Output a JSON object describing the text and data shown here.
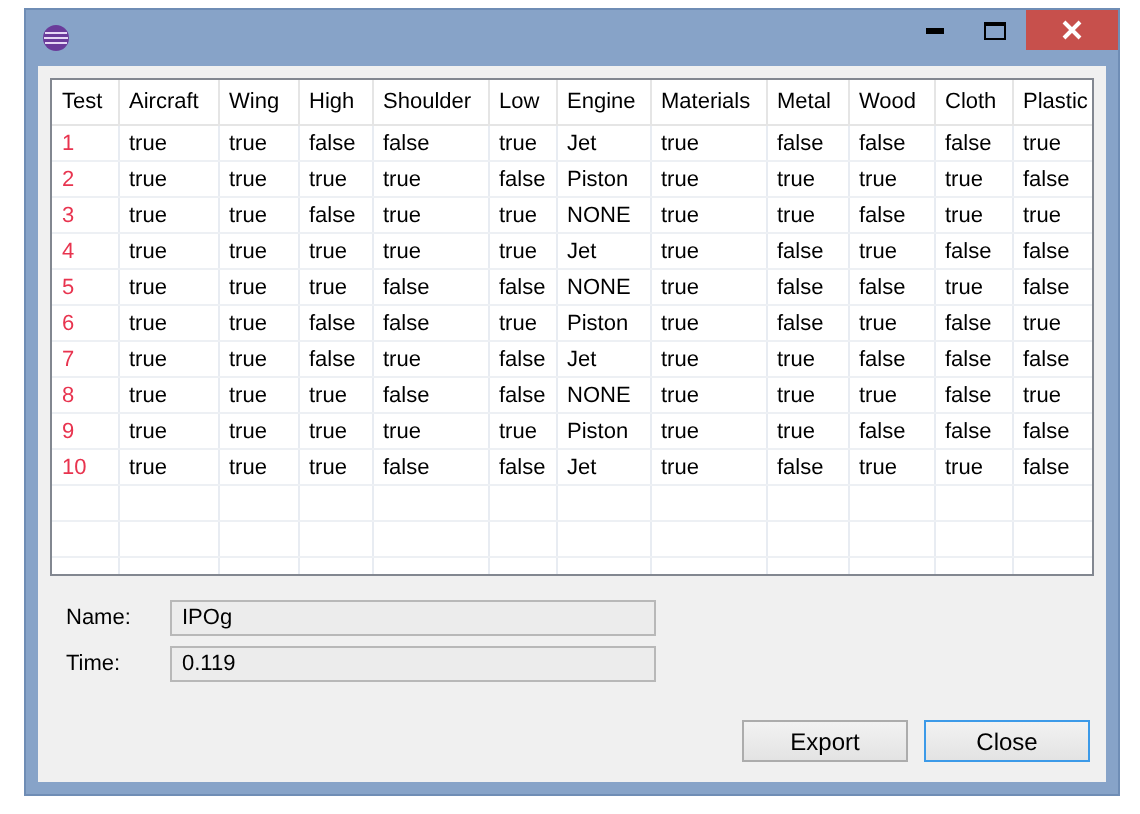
{
  "table": {
    "columns": [
      "Test",
      "Aircraft",
      "Wing",
      "High",
      "Shoulder",
      "Low",
      "Engine",
      "Materials",
      "Metal",
      "Wood",
      "Cloth",
      "Plastic"
    ],
    "rows": [
      [
        "1",
        "true",
        "true",
        "false",
        "false",
        "true",
        "Jet",
        "true",
        "false",
        "false",
        "false",
        "true"
      ],
      [
        "2",
        "true",
        "true",
        "true",
        "true",
        "false",
        "Piston",
        "true",
        "true",
        "true",
        "true",
        "false"
      ],
      [
        "3",
        "true",
        "true",
        "false",
        "true",
        "true",
        "NONE",
        "true",
        "true",
        "false",
        "true",
        "true"
      ],
      [
        "4",
        "true",
        "true",
        "true",
        "true",
        "true",
        "Jet",
        "true",
        "false",
        "true",
        "false",
        "false"
      ],
      [
        "5",
        "true",
        "true",
        "true",
        "false",
        "false",
        "NONE",
        "true",
        "false",
        "false",
        "true",
        "false"
      ],
      [
        "6",
        "true",
        "true",
        "false",
        "false",
        "true",
        "Piston",
        "true",
        "false",
        "true",
        "false",
        "true"
      ],
      [
        "7",
        "true",
        "true",
        "false",
        "true",
        "false",
        "Jet",
        "true",
        "true",
        "false",
        "false",
        "false"
      ],
      [
        "8",
        "true",
        "true",
        "true",
        "false",
        "false",
        "NONE",
        "true",
        "true",
        "true",
        "false",
        "true"
      ],
      [
        "9",
        "true",
        "true",
        "true",
        "true",
        "true",
        "Piston",
        "true",
        "true",
        "false",
        "false",
        "false"
      ],
      [
        "10",
        "true",
        "true",
        "true",
        "false",
        "false",
        "Jet",
        "true",
        "false",
        "true",
        "true",
        "false"
      ]
    ]
  },
  "fields": [
    {
      "label": "Name:",
      "value": "IPOg"
    },
    {
      "label": "Time:",
      "value": "0.119"
    }
  ],
  "buttons": [
    {
      "label": "Export",
      "default": false
    },
    {
      "label": "Close",
      "default": true
    }
  ]
}
